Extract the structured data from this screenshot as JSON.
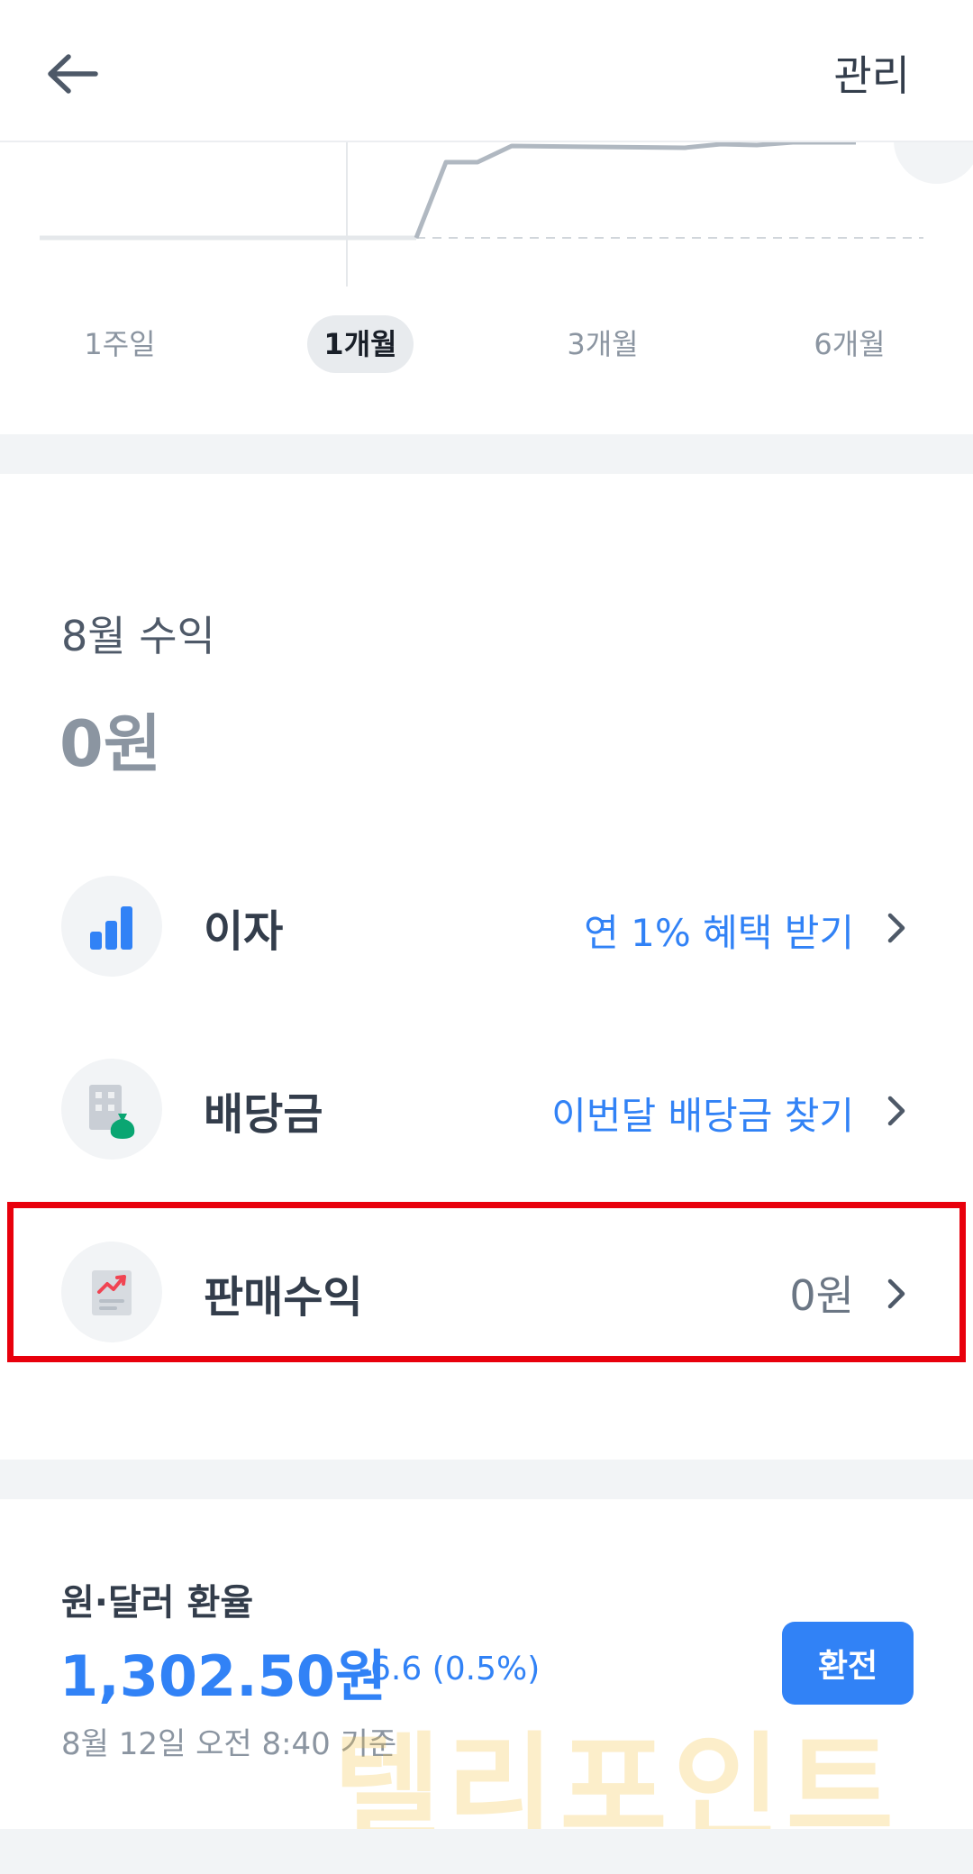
{
  "header": {
    "manage_label": "관리"
  },
  "period_tabs": [
    {
      "label": "1주일",
      "active": false
    },
    {
      "label": "1개월",
      "active": true
    },
    {
      "label": "3개월",
      "active": false
    },
    {
      "label": "6개월",
      "active": false
    }
  ],
  "earnings": {
    "month_title": "8월 수익",
    "amount": "0원",
    "rows": [
      {
        "label": "이자",
        "value": "연 1% 혜택 받기",
        "icon": "bar-chart-icon"
      },
      {
        "label": "배당금",
        "value": "이번달 배당금 찾기",
        "icon": "building-money-bag-icon"
      },
      {
        "label": "판매수익",
        "value": "0원",
        "icon": "trend-document-icon"
      }
    ]
  },
  "exchange": {
    "title": "원·달러 환율",
    "rate": "1,302.50원",
    "change": "-6.6 (0.5%)",
    "timestamp": "8월 12일 오전 8:40 기준",
    "button_label": "환전"
  },
  "watermark_text": "텔리포인트",
  "colors": {
    "accent": "#3182f6",
    "highlight": "#e8000c",
    "text": "#333d4b",
    "muted": "#8b95a1"
  }
}
